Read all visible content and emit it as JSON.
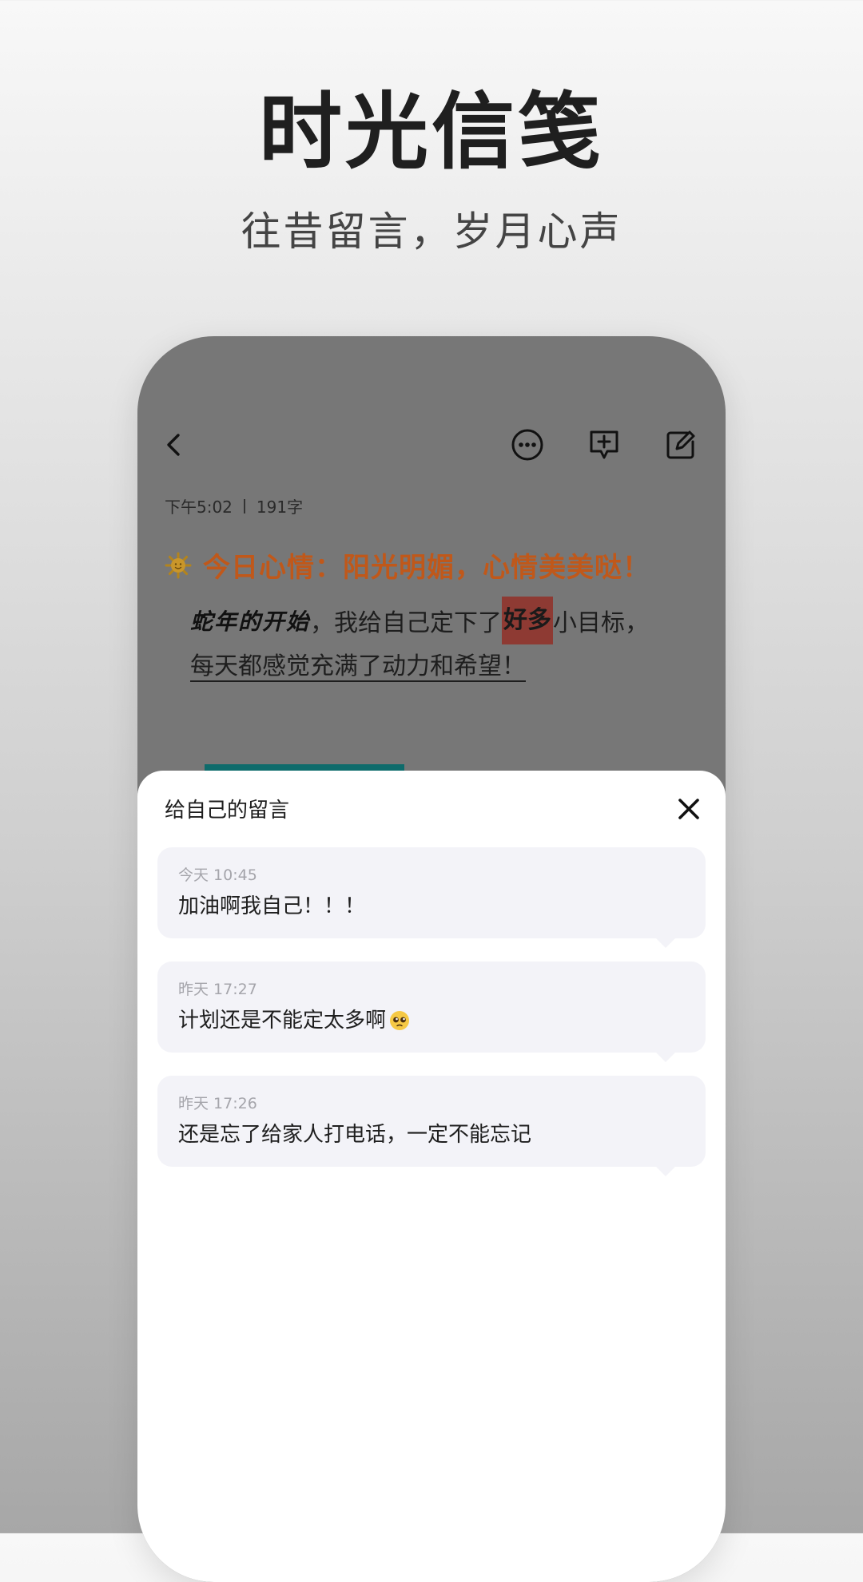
{
  "promo": {
    "title": "时光信笺",
    "subtitle": "往昔留言，岁月心声"
  },
  "note": {
    "time": "下午5:02",
    "word_count": "191字",
    "mood_icon": "sun-emoji",
    "mood_text": "今日心情：阳光明媚，心情美美哒！",
    "line1_italic": "蛇年的开始",
    "line1_mid": "，我给自己定下了",
    "line1_highlight": "好多",
    "line1_end": "小目标，",
    "line2": "每天都感觉充满了动力和希望！"
  },
  "toolbar": {
    "icons": [
      "back-chevron-icon",
      "more-circle-icon",
      "add-comment-icon",
      "edit-icon"
    ]
  },
  "sheet": {
    "title": "给自己的留言",
    "close_icon": "close-icon",
    "messages": [
      {
        "time": "今天 10:45",
        "text": "加油啊我自己！！！"
      },
      {
        "time": "昨天 17:27",
        "text": "计划还是不能定太多啊",
        "emoji": "pleading-face-emoji"
      },
      {
        "time": "昨天 17:26",
        "text": "还是忘了给家人打电话，一定不能忘记"
      }
    ]
  },
  "colors": {
    "mood_orange": "#c0581a",
    "highlight": "#8e3a33",
    "teal": "#0e6b6b",
    "card_bg": "#f3f3f8"
  }
}
